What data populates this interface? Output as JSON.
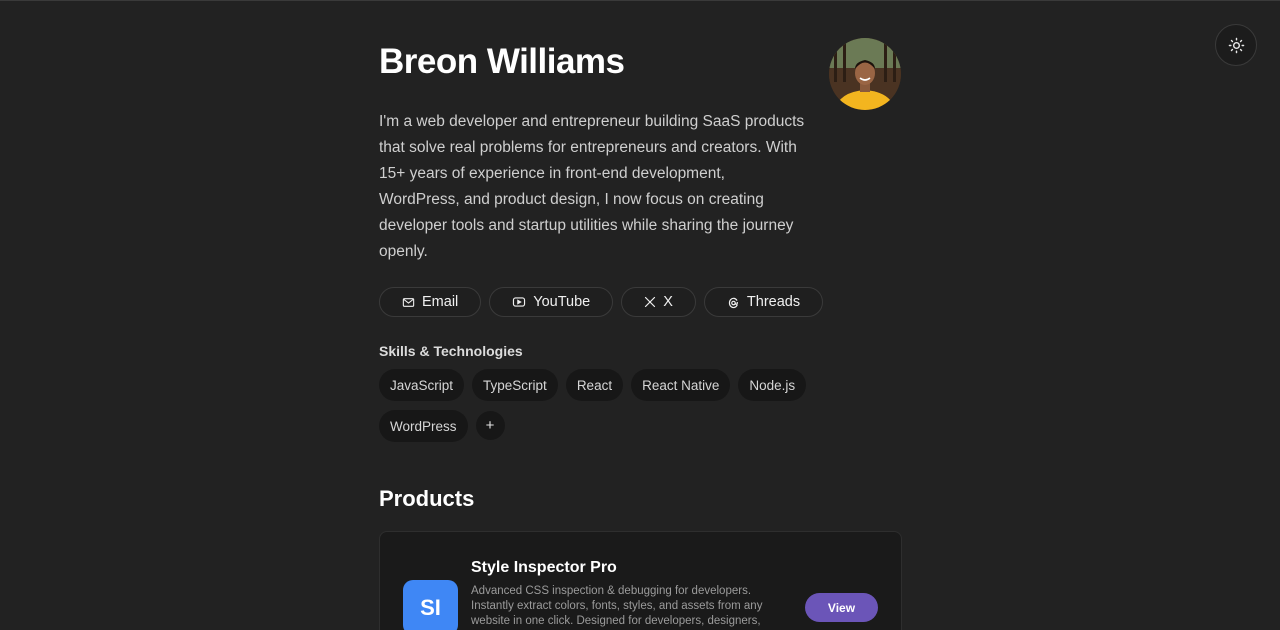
{
  "profile": {
    "name": "Breon Williams",
    "bio": "I'm a web developer and entrepreneur building SaaS products that solve real problems for entrepreneurs and creators. With 15+ years of experience in front-end development, WordPress, and product design, I now focus on creating developer tools and startup utilities while sharing the journey openly."
  },
  "socials": [
    {
      "label": "Email",
      "icon": "mail-icon"
    },
    {
      "label": "YouTube",
      "icon": "youtube-icon"
    },
    {
      "label": "X",
      "icon": "x-icon"
    },
    {
      "label": "Threads",
      "icon": "threads-icon"
    }
  ],
  "skills": {
    "title": "Skills & Technologies",
    "items": [
      "JavaScript",
      "TypeScript",
      "React",
      "React Native",
      "Node.js",
      "WordPress"
    ],
    "more_label": "+"
  },
  "products": {
    "title": "Products",
    "items": [
      {
        "logo_text": "SI",
        "name": "Style Inspector Pro",
        "description": "Advanced CSS inspection & debugging for developers. Instantly extract colors, fonts, styles, and assets from any website in one click. Designed for developers, designers,",
        "button_label": "View"
      }
    ]
  },
  "theme": {
    "icon": "sun-icon"
  },
  "colors": {
    "background": "#222222",
    "accent_button": "#6b55b8",
    "product_logo": "#3f87f5"
  }
}
